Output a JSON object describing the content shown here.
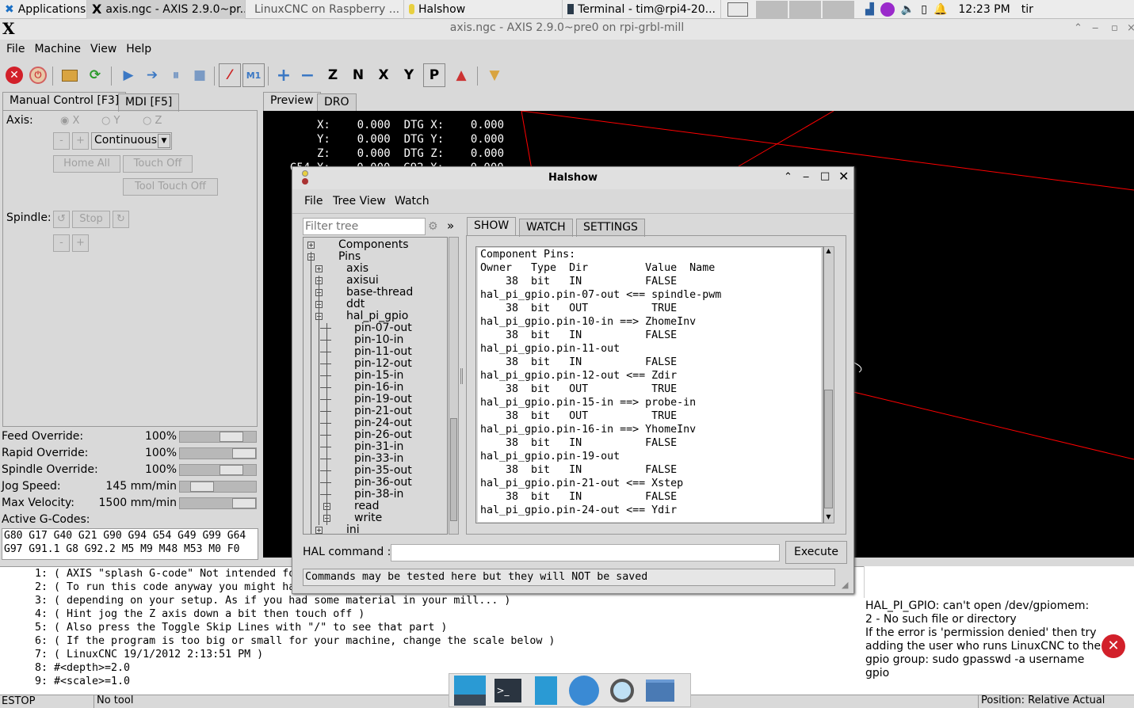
{
  "taskbar": {
    "apps_label": "Applications",
    "windows": [
      {
        "label": "axis.ngc - AXIS 2.9.0~pr..."
      },
      {
        "label": "LinuxCNC on Raspberry ..."
      },
      {
        "label": "Halshow"
      },
      {
        "label": "Terminal - tim@rpi4-20..."
      }
    ],
    "clock": "12:23 PM",
    "user": "tir"
  },
  "window": {
    "title": "axis.ngc - AXIS 2.9.0~pre0 on rpi-grbl-mill"
  },
  "menu": [
    "File",
    "Machine",
    "View",
    "Help"
  ],
  "tabs_left": [
    "Manual Control [F3]",
    "MDI [F5]"
  ],
  "tabs_right": [
    "Preview",
    "DRO"
  ],
  "manual": {
    "axis_label": "Axis:",
    "axes": [
      "X",
      "Y",
      "Z"
    ],
    "minus": "-",
    "plus": "+",
    "jog_mode": "Continuous",
    "home_all": "Home All",
    "touch_off": "Touch Off",
    "tool_touch_off": "Tool Touch Off",
    "spindle_label": "Spindle:",
    "stop": "Stop"
  },
  "overrides": [
    {
      "label": "Feed Override:",
      "value": "100%",
      "level": 0.75
    },
    {
      "label": "Rapid Override:",
      "value": "100%",
      "level": 1.0
    },
    {
      "label": "Spindle Override:",
      "value": "100%",
      "level": 0.75
    },
    {
      "label": "Jog Speed:",
      "value": "145 mm/min",
      "level": 0.2
    },
    {
      "label": "Max Velocity:",
      "value": "1500 mm/min",
      "level": 1.0
    }
  ],
  "gcodes": {
    "label": "Active G-Codes:",
    "line1": "G80 G17 G40 G21 G90 G94 G54 G49 G99 G64",
    "line2": "G97 G91.1 G8 G92.2 M5 M9 M48 M53 M0 F0"
  },
  "dro": {
    "line1": "X:    0.000  DTG X:    0.000",
    "line2": "Y:    0.000  DTG Y:    0.000",
    "line3": "Z:    0.000  DTG Z:    0.000",
    "partial": "G54 X:    0.000  G92 X:    0.000"
  },
  "halshow": {
    "title": "Halshow",
    "menu": [
      "File",
      "Tree View",
      "Watch"
    ],
    "filter_placeholder": "Filter tree",
    "expand": "»",
    "tabs": [
      "SHOW",
      "WATCH",
      "SETTINGS"
    ],
    "tree": [
      {
        "label": "Components",
        "depth": 0,
        "exp": "+"
      },
      {
        "label": "Pins",
        "depth": 0,
        "exp": "-"
      },
      {
        "label": "axis",
        "depth": 1,
        "exp": "+"
      },
      {
        "label": "axisui",
        "depth": 1,
        "exp": "+"
      },
      {
        "label": "base-thread",
        "depth": 1,
        "exp": "+"
      },
      {
        "label": "ddt",
        "depth": 1,
        "exp": "+"
      },
      {
        "label": "hal_pi_gpio",
        "depth": 1,
        "exp": "-"
      },
      {
        "label": "pin-07-out",
        "depth": 2,
        "exp": ""
      },
      {
        "label": "pin-10-in",
        "depth": 2,
        "exp": ""
      },
      {
        "label": "pin-11-out",
        "depth": 2,
        "exp": ""
      },
      {
        "label": "pin-12-out",
        "depth": 2,
        "exp": ""
      },
      {
        "label": "pin-15-in",
        "depth": 2,
        "exp": ""
      },
      {
        "label": "pin-16-in",
        "depth": 2,
        "exp": ""
      },
      {
        "label": "pin-19-out",
        "depth": 2,
        "exp": ""
      },
      {
        "label": "pin-21-out",
        "depth": 2,
        "exp": ""
      },
      {
        "label": "pin-24-out",
        "depth": 2,
        "exp": ""
      },
      {
        "label": "pin-26-out",
        "depth": 2,
        "exp": ""
      },
      {
        "label": "pin-31-in",
        "depth": 2,
        "exp": ""
      },
      {
        "label": "pin-33-in",
        "depth": 2,
        "exp": ""
      },
      {
        "label": "pin-35-out",
        "depth": 2,
        "exp": ""
      },
      {
        "label": "pin-36-out",
        "depth": 2,
        "exp": ""
      },
      {
        "label": "pin-38-in",
        "depth": 2,
        "exp": ""
      },
      {
        "label": "read",
        "depth": 2,
        "exp": "+"
      },
      {
        "label": "write",
        "depth": 2,
        "exp": "+"
      },
      {
        "label": "ini",
        "depth": 1,
        "exp": "+"
      }
    ],
    "show_lines": [
      "Component Pins:",
      "Owner   Type  Dir         Value  Name",
      "    38  bit   IN          FALSE",
      "hal_pi_gpio.pin-07-out <== spindle-pwm",
      "    38  bit   OUT          TRUE",
      "hal_pi_gpio.pin-10-in ==> ZhomeInv",
      "    38  bit   IN          FALSE",
      "hal_pi_gpio.pin-11-out",
      "    38  bit   IN          FALSE",
      "hal_pi_gpio.pin-12-out <== Zdir",
      "    38  bit   OUT          TRUE",
      "hal_pi_gpio.pin-15-in ==> probe-in",
      "    38  bit   OUT          TRUE",
      "hal_pi_gpio.pin-16-in ==> YhomeInv",
      "    38  bit   IN          FALSE",
      "hal_pi_gpio.pin-19-out",
      "    38  bit   IN          FALSE",
      "hal_pi_gpio.pin-21-out <== Xstep",
      "    38  bit   IN          FALSE",
      "hal_pi_gpio.pin-24-out <== Ydir"
    ],
    "hal_command_label": "HAL command :",
    "execute": "Execute",
    "status": "Commands may be tested here but they will NOT be saved"
  },
  "gcode_lines": [
    {
      "n": "1:",
      "t": "( AXIS \"splash G-code\" Not intended fo"
    },
    {
      "n": "2:",
      "t": "( To run this code anyway you might ha"
    },
    {
      "n": "3:",
      "t": "( depending on your setup. As if you had some material in your mill... )"
    },
    {
      "n": "4:",
      "t": "( Hint jog the Z axis down a bit then touch off )"
    },
    {
      "n": "5:",
      "t": "( Also press the Toggle Skip Lines with \"/\" to see that part )"
    },
    {
      "n": "6:",
      "t": "( If the program is too big or small for your machine, change the scale below )"
    },
    {
      "n": "7:",
      "t": "( LinuxCNC 19/1/2012 2:13:51 PM )"
    },
    {
      "n": "8:",
      "t": "#<depth>=2.0"
    },
    {
      "n": "9:",
      "t": "#<scale>=1.0"
    }
  ],
  "error": {
    "text": "HAL_PI_GPIO: can't open /dev/gpiomem:  2 - No such file or directory\nIf the error is 'permission denied' then try adding the user who runs LinuxCNC to the gpio group: sudo gpasswd -a username gpio"
  },
  "status": {
    "estop": "ESTOP",
    "tool": "No tool",
    "position": "Position: Relative Actual"
  },
  "colors": {
    "preview_bg": "#000000",
    "toolpath": "#ff0000",
    "accent": "#3b78c4"
  }
}
